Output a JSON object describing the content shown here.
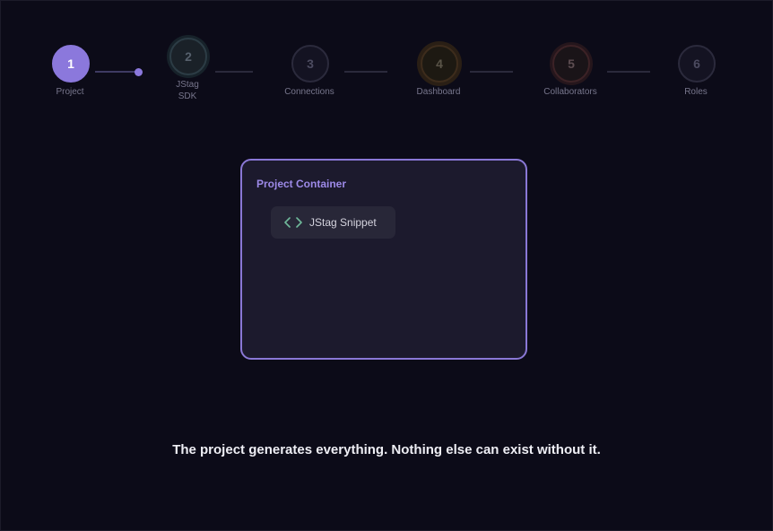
{
  "stepper": {
    "steps": [
      {
        "number": "1",
        "label": "Project",
        "state": "active"
      },
      {
        "number": "2",
        "label": "JStag SDK",
        "state": "pending"
      },
      {
        "number": "3",
        "label": "Connections",
        "state": "pending"
      },
      {
        "number": "4",
        "label": "Dashboard",
        "state": "pending"
      },
      {
        "number": "5",
        "label": "Collaborators",
        "state": "pending"
      },
      {
        "number": "6",
        "label": "Roles",
        "state": "pending"
      }
    ],
    "progress_fraction": 0.5
  },
  "project_container": {
    "title": "Project Container",
    "chip": {
      "icon": "code-brackets-icon",
      "label": "JStag Snippet"
    }
  },
  "caption": "The project generates everything. Nothing else can exist without it.",
  "colors": {
    "background": "#0c0b18",
    "accent": "#8b78dc",
    "code_icon": "#6fb89a",
    "card": "#1c1a2d"
  }
}
